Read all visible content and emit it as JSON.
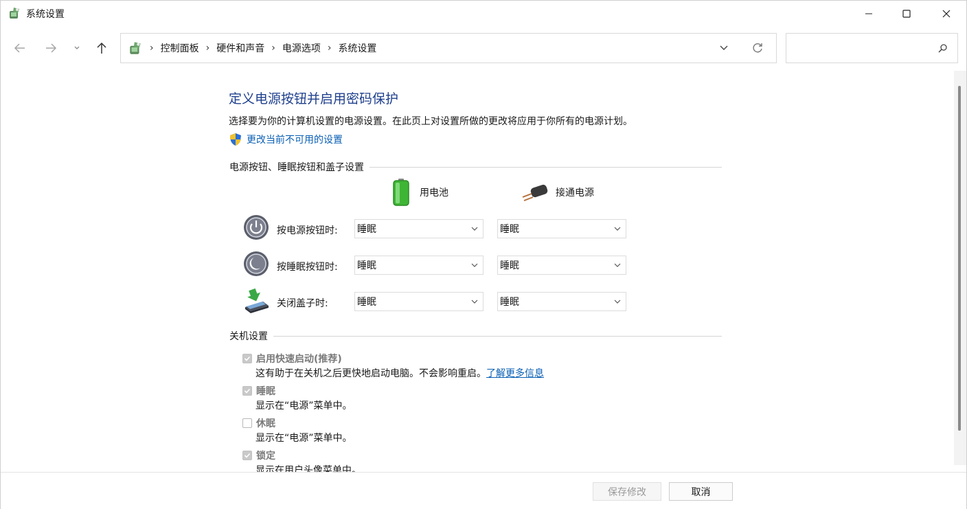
{
  "window": {
    "title": "系统设置",
    "minimize_icon": "minimize-icon",
    "maximize_icon": "maximize-icon",
    "close_icon": "close-icon"
  },
  "nav": {
    "back_icon": "arrow-left-icon",
    "forward_icon": "arrow-right-icon",
    "recent_icon": "chevron-down-icon",
    "up_icon": "arrow-up-icon"
  },
  "address": {
    "breadcrumbs": [
      "控制面板",
      "硬件和声音",
      "电源选项",
      "系统设置"
    ],
    "search_placeholder": ""
  },
  "page": {
    "title": "定义电源按钮并启用密码保护",
    "description": "选择要为你的计算机设置的电源设置。在此页上对设置所做的更改将应用于你所有的电源计划。",
    "change_link": "更改当前不可用的设置"
  },
  "power_buttons": {
    "section_title": "电源按钮、睡眠按钮和盖子设置",
    "battery_label": "用电池",
    "plugged_label": "接通电源",
    "rows": [
      {
        "label": "按电源按钮时:",
        "battery": "睡眠",
        "plugged": "睡眠"
      },
      {
        "label": "按睡眠按钮时:",
        "battery": "睡眠",
        "plugged": "睡眠"
      },
      {
        "label": "关闭盖子时:",
        "battery": "睡眠",
        "plugged": "睡眠"
      }
    ]
  },
  "shutdown": {
    "section_title": "关机设置",
    "items": [
      {
        "label": "启用快速启动(推荐)",
        "checked": true,
        "desc": "这有助于在关机之后更快地启动电脑。不会影响重启。",
        "link": "了解更多信息"
      },
      {
        "label": "睡眠",
        "checked": true,
        "desc": "显示在“电源”菜单中。"
      },
      {
        "label": "休眠",
        "checked": false,
        "desc": "显示在“电源”菜单中。"
      },
      {
        "label": "锁定",
        "checked": true,
        "desc": "显示在用户头像菜单中。"
      }
    ]
  },
  "footer": {
    "save_label": "保存修改",
    "cancel_label": "取消"
  },
  "colors": {
    "title_blue": "#1e3f8c",
    "link_blue": "#0a5fb4"
  }
}
